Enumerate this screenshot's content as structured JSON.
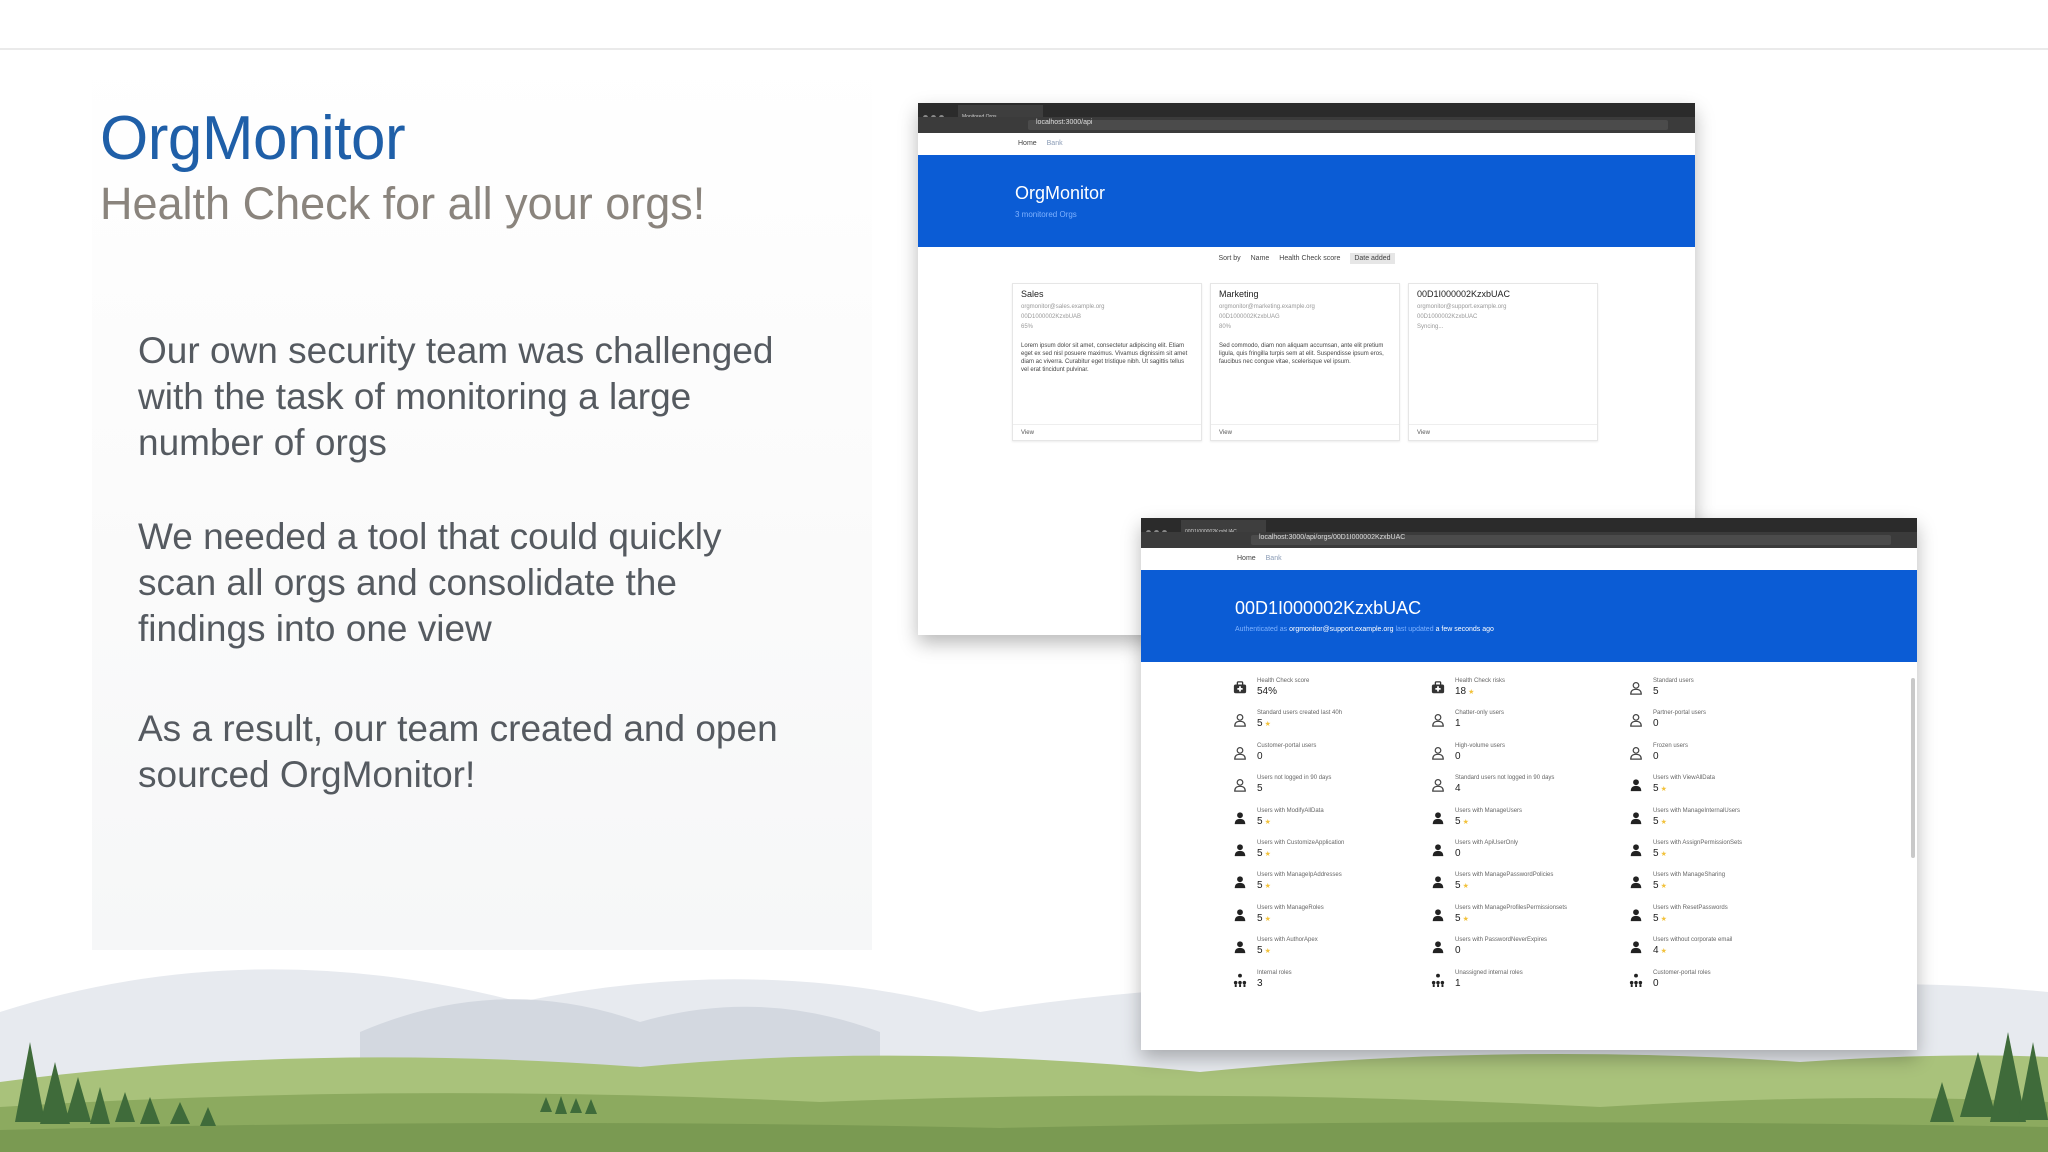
{
  "slide": {
    "title": "OrgMonitor",
    "subtitle": "Health Check for all your orgs!",
    "paragraphs": [
      [
        "Our own security team was challenged",
        "with the task of monitoring a large",
        "number of orgs"
      ],
      [
        "We needed a tool that could quickly",
        "scan all orgs and consolidate the",
        "findings into one view"
      ],
      [
        "As a result, our team created and open",
        "sourced OrgMonitor!"
      ]
    ]
  },
  "browser1": {
    "tab_label": "Monitored Orgs",
    "url": "localhost:3000/api",
    "nav": {
      "home": "Home",
      "bank": "Bank"
    },
    "hero_title": "OrgMonitor",
    "hero_sub": "3 monitored Orgs",
    "sort": {
      "label": "Sort by",
      "options": [
        "Name",
        "Health Check score",
        "Date added"
      ],
      "active": "Date added"
    },
    "cards": [
      {
        "name": "Sales",
        "email": "orgmonitor@sales.example.org",
        "org_id": "00D1000002KzxbUAB",
        "score": "65%",
        "desc": "Lorem ipsum dolor sit amet, consectetur adipiscing elit. Etiam eget ex sed nisl posuere maximus. Vivamus dignissim sit amet diam ac viverra. Curabitur eget tristique nibh. Ut sagittis tellus vel erat tincidunt pulvinar.",
        "view": "View"
      },
      {
        "name": "Marketing",
        "email": "orgmonitor@marketing.example.org",
        "org_id": "00D1000002KzxbUAG",
        "score": "80%",
        "desc": "Sed commodo, diam non aliquam accumsan, ante elit pretium ligula, quis fringilla turpis sem at elit. Suspendisse ipsum eros, faucibus nec congue vitae, scelerisque vel ipsum.",
        "view": "View"
      },
      {
        "name": "00D1I000002KzxbUAC",
        "email": "orgmonitor@support.example.org",
        "org_id": "00D1000002KzxbUAC",
        "score": "Syncing...",
        "desc": "",
        "view": "View"
      }
    ]
  },
  "browser2": {
    "tab_label": "00D1I000002KzxbUAC",
    "url": "localhost:3000/api/orgs/00D1I000002KzxbUAC",
    "nav": {
      "home": "Home",
      "bank": "Bank"
    },
    "hero_title": "00D1I000002KzxbUAC",
    "hero_sub_prefix": "Authenticated as",
    "hero_email": "orgmonitor@support.example.org",
    "hero_sub_mid": "last updated",
    "hero_when": "a few seconds ago",
    "metrics": [
      {
        "label": "Health Check score",
        "value": "54%",
        "icon": "medkit-icon",
        "star": false
      },
      {
        "label": "Health Check risks",
        "value": "18",
        "icon": "medkit-icon",
        "star": true
      },
      {
        "label": "Standard users",
        "value": "5",
        "icon": "user-outline-icon",
        "star": false
      },
      {
        "label": "Standard users created last 40h",
        "value": "5",
        "icon": "user-outline-icon",
        "star": true
      },
      {
        "label": "Chatter-only users",
        "value": "1",
        "icon": "user-outline-icon",
        "star": false
      },
      {
        "label": "Partner-portal users",
        "value": "0",
        "icon": "user-outline-icon",
        "star": false
      },
      {
        "label": "Customer-portal users",
        "value": "0",
        "icon": "user-outline-icon",
        "star": false
      },
      {
        "label": "High-volume users",
        "value": "0",
        "icon": "user-outline-icon",
        "star": false
      },
      {
        "label": "Frozen users",
        "value": "0",
        "icon": "user-outline-icon",
        "star": false
      },
      {
        "label": "Users not logged in 90 days",
        "value": "5",
        "icon": "user-outline-icon",
        "star": false
      },
      {
        "label": "Standard users not logged in 90 days",
        "value": "4",
        "icon": "user-outline-icon",
        "star": false
      },
      {
        "label": "Users with ViewAllData",
        "value": "5",
        "icon": "user-solid-icon",
        "star": true
      },
      {
        "label": "Users with ModifyAllData",
        "value": "5",
        "icon": "user-solid-icon",
        "star": true
      },
      {
        "label": "Users with ManageUsers",
        "value": "5",
        "icon": "user-solid-icon",
        "star": true
      },
      {
        "label": "Users with ManageInternalUsers",
        "value": "5",
        "icon": "user-solid-icon",
        "star": true
      },
      {
        "label": "Users with CustomizeApplication",
        "value": "5",
        "icon": "user-solid-icon",
        "star": true
      },
      {
        "label": "Users with ApiUserOnly",
        "value": "0",
        "icon": "user-solid-icon",
        "star": false
      },
      {
        "label": "Users with AssignPermissionSets",
        "value": "5",
        "icon": "user-solid-icon",
        "star": true
      },
      {
        "label": "Users with ManageIpAddresses",
        "value": "5",
        "icon": "user-solid-icon",
        "star": true
      },
      {
        "label": "Users with ManagePasswordPolicies",
        "value": "5",
        "icon": "user-solid-icon",
        "star": true
      },
      {
        "label": "Users with ManageSharing",
        "value": "5",
        "icon": "user-solid-icon",
        "star": true
      },
      {
        "label": "Users with ManageRoles",
        "value": "5",
        "icon": "user-solid-icon",
        "star": true
      },
      {
        "label": "Users with ManageProfilesPermissionsets",
        "value": "5",
        "icon": "user-solid-icon",
        "star": true
      },
      {
        "label": "Users with ResetPasswords",
        "value": "5",
        "icon": "user-solid-icon",
        "star": true
      },
      {
        "label": "Users with AuthorApex",
        "value": "5",
        "icon": "user-solid-icon",
        "star": true
      },
      {
        "label": "Users with PasswordNeverExpires",
        "value": "0",
        "icon": "user-solid-icon",
        "star": false
      },
      {
        "label": "Users without corporate email",
        "value": "4",
        "icon": "user-solid-icon",
        "star": true
      },
      {
        "label": "Internal roles",
        "value": "3",
        "icon": "hierarchy-icon",
        "star": false
      },
      {
        "label": "Unassigned internal roles",
        "value": "1",
        "icon": "hierarchy-icon",
        "star": false
      },
      {
        "label": "Customer-portal roles",
        "value": "0",
        "icon": "hierarchy-icon",
        "star": false
      }
    ]
  },
  "colors": {
    "title": "#1f5fa8",
    "subtitle": "#8a847d",
    "body": "#555a60",
    "hero": "#0b5cd5"
  }
}
